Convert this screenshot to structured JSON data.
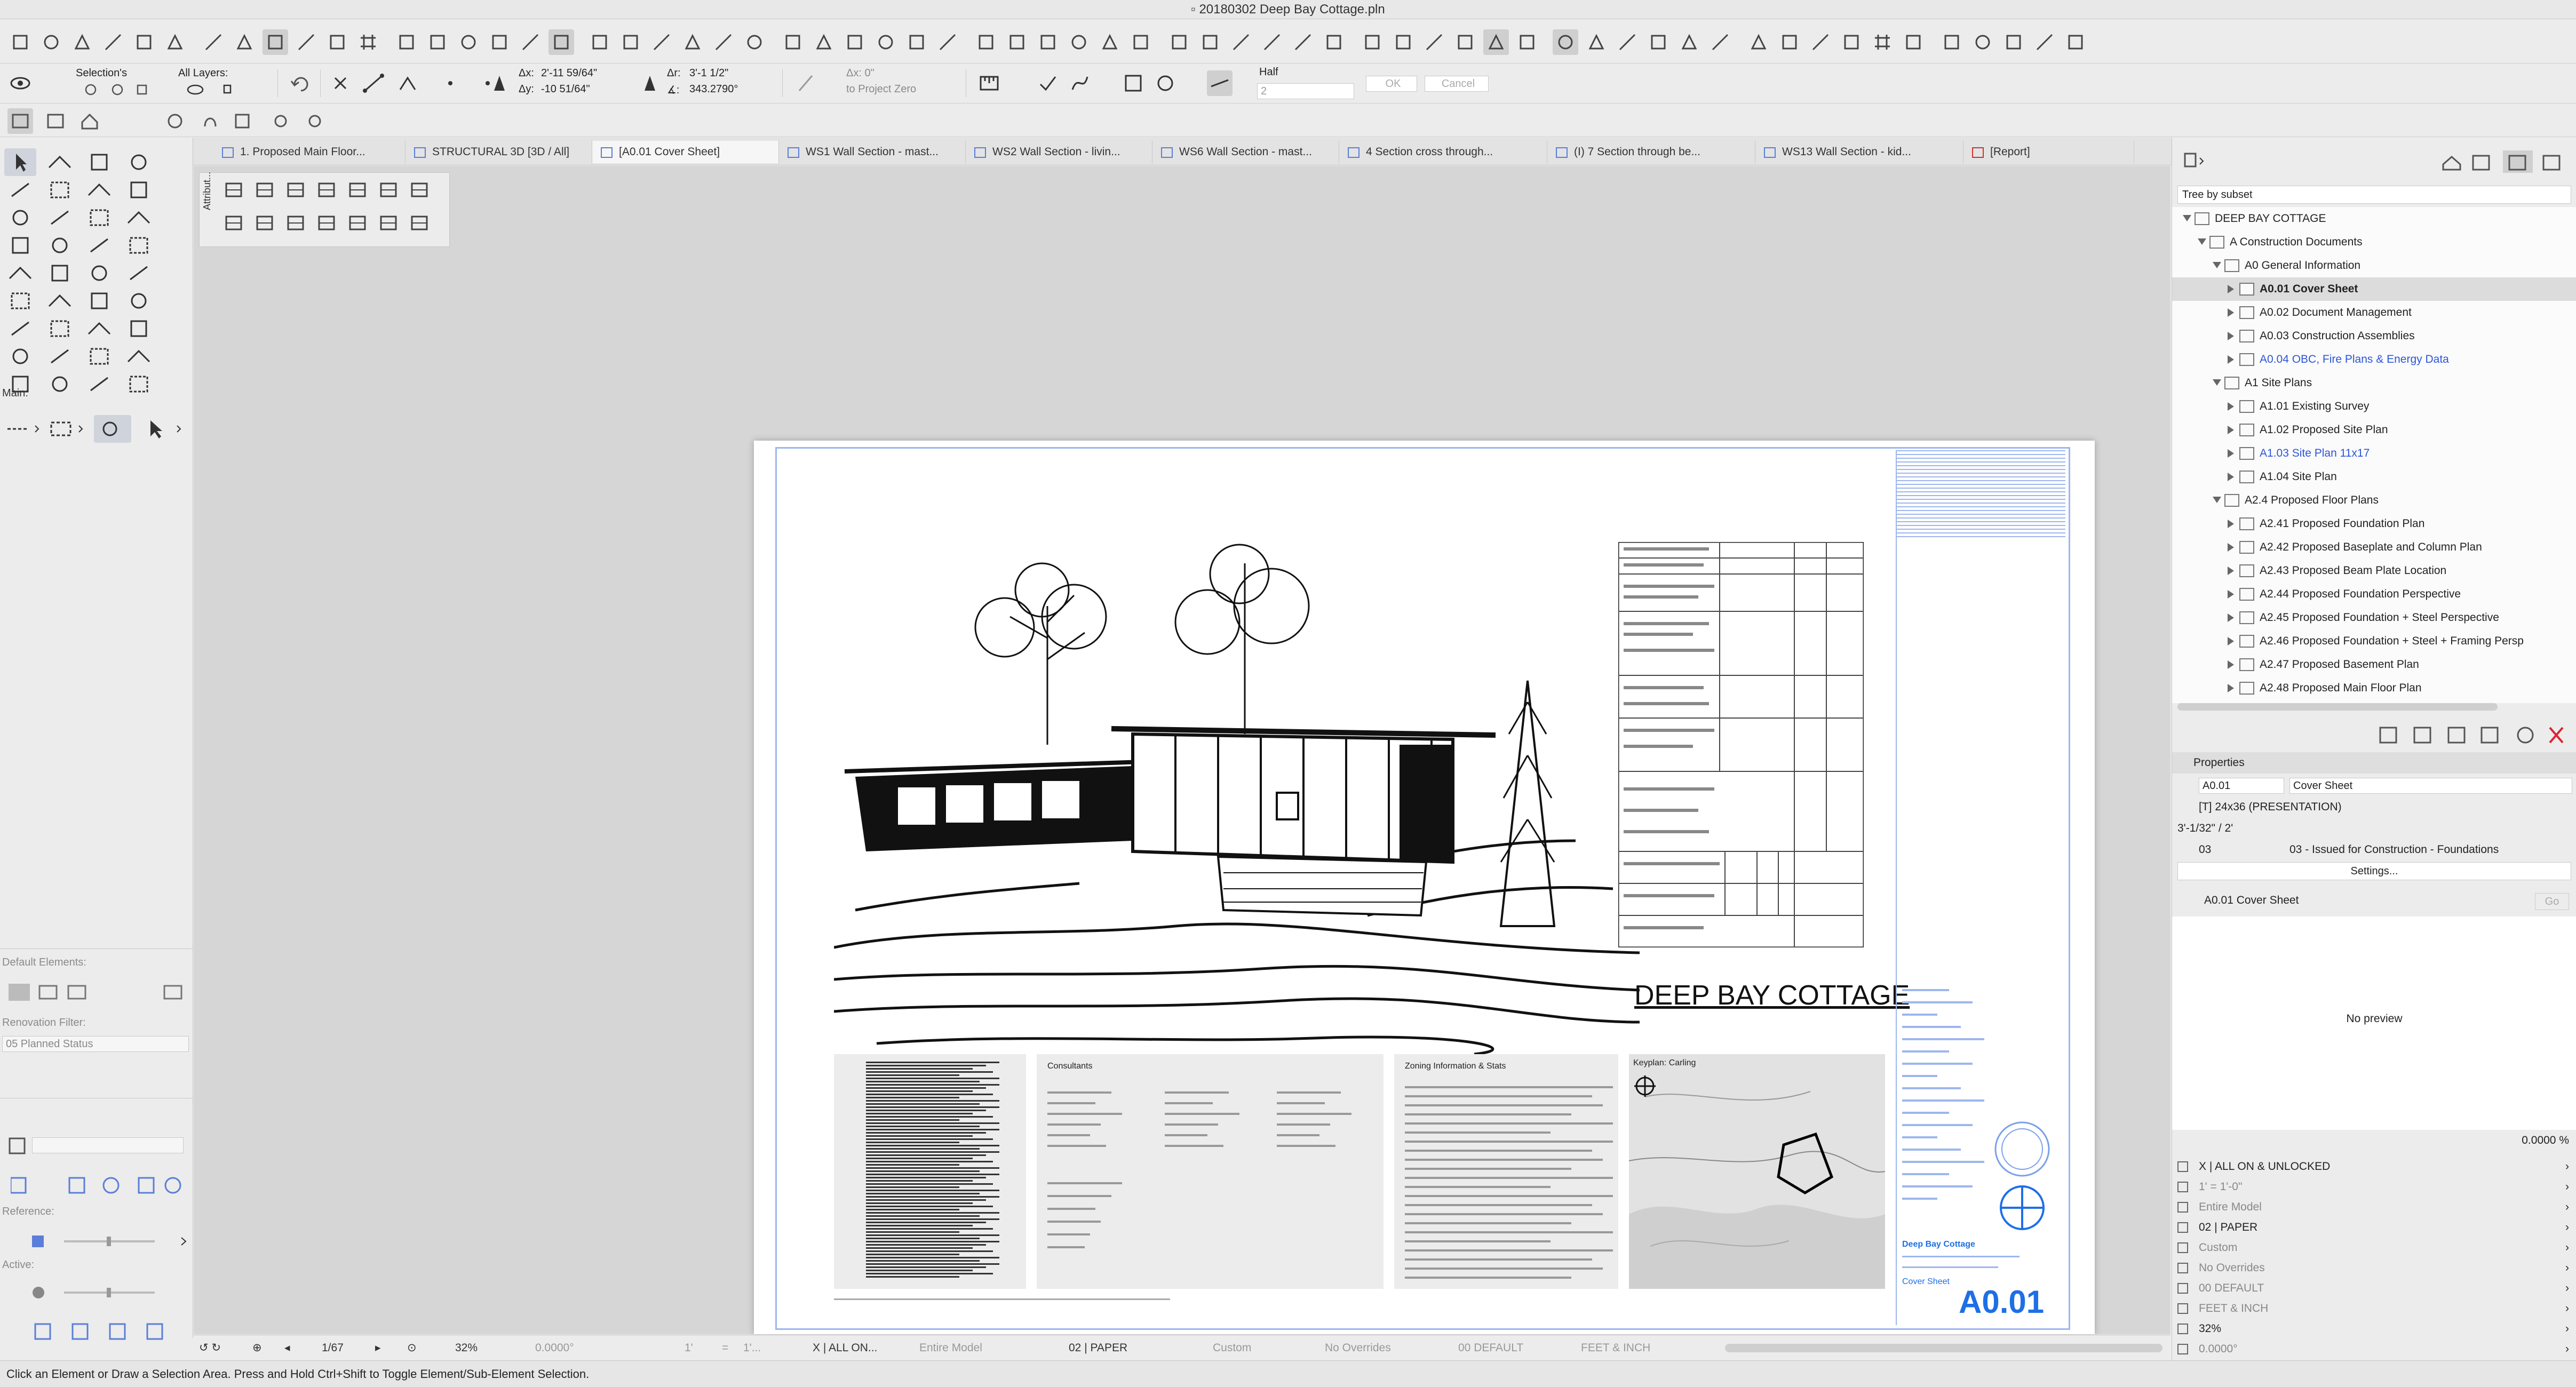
{
  "window": {
    "title": "20180302 Deep Bay Cottage.pln"
  },
  "infobox": {
    "selections_label": "Selection's",
    "layers_label": "All Layers:",
    "dx_label": "Δx:",
    "dx_value": "2'-11 59/64\"",
    "dy_label": "Δy:",
    "dy_value": "-10 51/64\"",
    "dr_label": "Δr:",
    "dr_value": "3'-1 1/2\"",
    "da_label": "∡:",
    "da_value": "343.2790°",
    "angle_value": "Δx: 0\"",
    "project_zero": "to Project Zero",
    "half_label": "Half",
    "half_value": "2",
    "ok_label": "OK",
    "cancel_label": "Cancel"
  },
  "tabs": [
    {
      "label": "1. Proposed Main Floor..."
    },
    {
      "label": "STRUCTURAL 3D [3D / All]"
    },
    {
      "label": "[A0.01 Cover Sheet]",
      "active": true
    },
    {
      "label": "WS1 Wall Section - mast..."
    },
    {
      "label": "WS2 Wall Section - livin..."
    },
    {
      "label": "WS6 Wall Section - mast..."
    },
    {
      "label": "4 Section cross through..."
    },
    {
      "label": "(I) 7 Section through be..."
    },
    {
      "label": "WS13 Wall Section - kid..."
    },
    {
      "label": "[Report]"
    }
  ],
  "toolbox": {
    "attributes_label": "Attribut...",
    "main_label": "Main:",
    "default_elements_label": "Default Elements:",
    "renovation_filter_label": "Renovation Filter:",
    "renovation_filter_value": "05 Planned Status",
    "reference_label": "Reference:",
    "active_label": "Active:"
  },
  "sheet": {
    "title": "DEEP BAY COTTAGE",
    "consultants_label": "Consultants",
    "zoning_label": "Zoning Information & Stats",
    "keyplan_label": "Keyplan: Carling",
    "titleblock_project": "Deep Bay Cottage",
    "titleblock_sheet": "Cover Sheet",
    "sheet_number": "A0.01"
  },
  "navigator": {
    "tree_mode": "Tree by subset",
    "items": [
      {
        "label": "DEEP BAY COTTAGE",
        "level": 0,
        "open": true,
        "icon": "book-icon"
      },
      {
        "label": "A Construction Documents",
        "level": 1,
        "open": true,
        "icon": "folder-icon"
      },
      {
        "label": "A0 General Information",
        "level": 2,
        "open": true,
        "icon": "folder-icon"
      },
      {
        "label": "A0.01 Cover Sheet",
        "level": 3,
        "selected": true,
        "icon": "layout-icon"
      },
      {
        "label": "A0.02 Document Management",
        "level": 3,
        "icon": "layout-icon"
      },
      {
        "label": "A0.03 Construction Assemblies",
        "level": 3,
        "icon": "layout-icon"
      },
      {
        "label": "A0.04 OBC, Fire Plans & Energy Data",
        "level": 3,
        "link": true,
        "icon": "layout-icon"
      },
      {
        "label": "A1 Site Plans",
        "level": 2,
        "open": true,
        "icon": "folder-icon"
      },
      {
        "label": "A1.01 Existing Survey",
        "level": 3,
        "icon": "layout-icon"
      },
      {
        "label": "A1.02 Proposed Site Plan",
        "level": 3,
        "icon": "layout-icon"
      },
      {
        "label": "A1.03 Site Plan 11x17",
        "level": 3,
        "link": true,
        "icon": "layout-icon"
      },
      {
        "label": "A1.04 Site Plan",
        "level": 3,
        "icon": "layout-icon"
      },
      {
        "label": "A2.4 Proposed Floor Plans",
        "level": 2,
        "open": true,
        "icon": "folder-icon"
      },
      {
        "label": "A2.41 Proposed Foundation Plan",
        "level": 3,
        "icon": "layout-icon"
      },
      {
        "label": "A2.42 Proposed Baseplate and Column Plan",
        "level": 3,
        "icon": "layout-icon"
      },
      {
        "label": "A2.43 Proposed Beam Plate Location",
        "level": 3,
        "icon": "layout-icon"
      },
      {
        "label": "A2.44 Proposed Foundation Perspective",
        "level": 3,
        "icon": "layout-icon"
      },
      {
        "label": "A2.45 Proposed Foundation + Steel Perspective",
        "level": 3,
        "icon": "layout-icon"
      },
      {
        "label": "A2.46 Proposed Foundation + Steel + Framing Persp",
        "level": 3,
        "icon": "layout-icon"
      },
      {
        "label": "A2.47 Proposed Basement Plan",
        "level": 3,
        "icon": "layout-icon"
      },
      {
        "label": "A2.48 Proposed Main Floor Plan",
        "level": 3,
        "icon": "layout-icon"
      }
    ],
    "properties_label": "Properties",
    "prop_id": "A0.01",
    "prop_name": "Cover Sheet",
    "prop_master": "[T] 24x36 (PRESENTATION)",
    "prop_scale": "3'-1/32\" / 2'",
    "prop_rev_id": "03",
    "prop_rev_name": "03 - Issued for Construction - Foundations",
    "settings_label": "Settings...",
    "preview_title": "A0.01 Cover Sheet",
    "go_label": "Go",
    "no_preview": "No preview",
    "zoom_value": "0.0000 %",
    "quick_options": [
      {
        "label": "X | ALL ON & UNLOCKED",
        "strong": true
      },
      {
        "label": "1'  =  1'-0\"",
        "strong": false
      },
      {
        "label": "Entire Model",
        "strong": false
      },
      {
        "label": "02 | PAPER",
        "strong": true
      },
      {
        "label": "Custom",
        "strong": false
      },
      {
        "label": "No Overrides",
        "strong": false
      },
      {
        "label": "00 DEFAULT",
        "strong": false
      },
      {
        "label": "FEET & INCH",
        "strong": false
      },
      {
        "label": "32%",
        "strong": true
      },
      {
        "label": "0.0000°",
        "strong": false
      }
    ]
  },
  "navbar": {
    "page": "1/67",
    "zoom": "32%",
    "angle": "0.0000°",
    "scale": "1'",
    "scale_eq": "=",
    "scale_val": "1'...",
    "layer": "X | ALL ON...",
    "model": "Entire Model",
    "pen": "02 | PAPER",
    "custom": "Custom",
    "overrides": "No Overrides",
    "renovation": "00 DEFAULT",
    "units": "FEET & INCH"
  },
  "status": {
    "message": "Click an Element or Draw a Selection Area. Press and Hold Ctrl+Shift to Toggle Element/Sub-Element Selection."
  },
  "colors": {
    "accent_blue": "#2d55d9",
    "titleblock_blue": "#1e6fe6",
    "selection_blue": "#8fb0f0"
  }
}
